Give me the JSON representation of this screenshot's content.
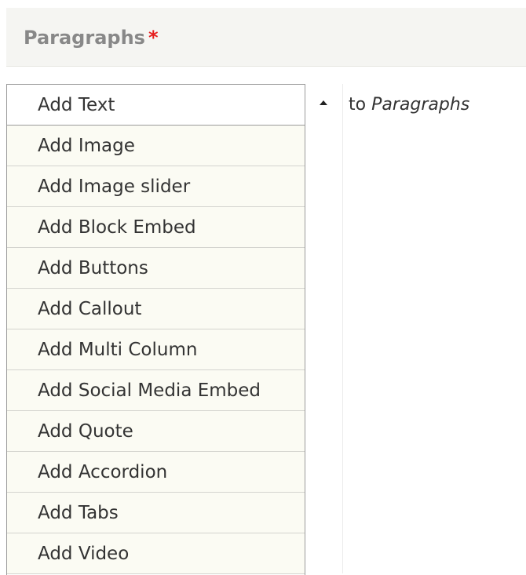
{
  "header": {
    "title": "Paragraphs",
    "required_marker": "*"
  },
  "dropdown": {
    "items": [
      {
        "label": "Add Text"
      },
      {
        "label": "Add Image"
      },
      {
        "label": "Add Image slider"
      },
      {
        "label": "Add Block Embed"
      },
      {
        "label": "Add Buttons"
      },
      {
        "label": "Add Callout"
      },
      {
        "label": "Add Multi Column"
      },
      {
        "label": "Add Social Media Embed"
      },
      {
        "label": "Add Quote"
      },
      {
        "label": "Add Accordion"
      },
      {
        "label": "Add Tabs"
      },
      {
        "label": "Add Video"
      }
    ],
    "toggle_icon": "caret-up-icon"
  },
  "target": {
    "prefix": "to",
    "field_name": "Paragraphs"
  }
}
